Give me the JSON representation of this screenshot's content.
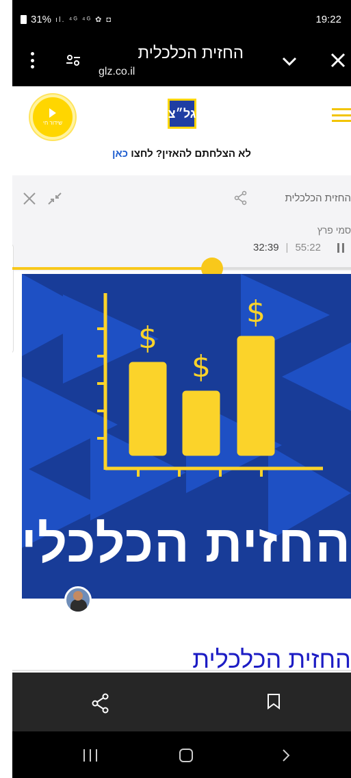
{
  "status_bar": {
    "battery": "31%",
    "signal_icons": "ıl. ⁴ᴳ ⁴ᴳ ✿ ◘",
    "time": "19:22"
  },
  "tab_header": {
    "title": "החזית הכלכלית",
    "url": "glz.co.il"
  },
  "site_header": {
    "live_button_label": "שידור חי",
    "logo_text": "גל״צ",
    "banner_text": "לא הצלחתם להאזין? לחצו ",
    "banner_link": "כאן"
  },
  "player": {
    "episode_title": "החזית הכלכלית",
    "author": "סמי פרץ",
    "elapsed": "32:39",
    "total": "55:22",
    "progress_fraction": 0.59
  },
  "cover": {
    "caption": "החזית הכלכלית",
    "colors": {
      "background": "#183c98",
      "triangles": "#1e50c4",
      "accent": "#fbd32a"
    }
  },
  "page": {
    "heading": "החזית הכלכלית"
  },
  "icons": {
    "menu": "kebab-icon",
    "tune": "tune-icon",
    "collapse": "chevron-down-icon",
    "close": "close-icon",
    "share": "share-icon",
    "bookmark": "bookmark-icon",
    "nav_recents": "recents-icon",
    "nav_home": "home-icon",
    "nav_back": "back-icon"
  }
}
